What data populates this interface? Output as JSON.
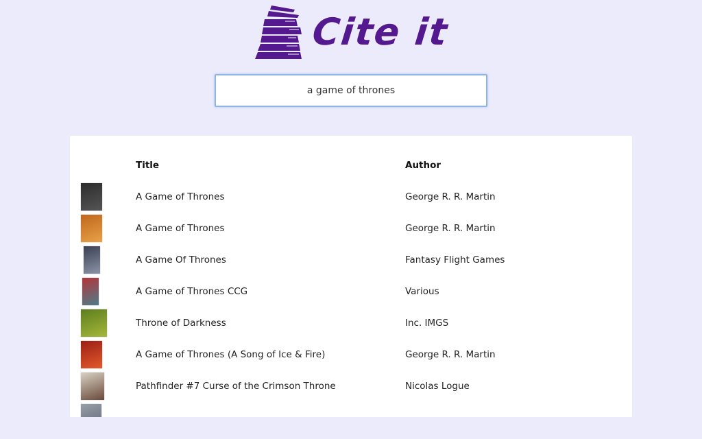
{
  "app": {
    "logo_text": "Cite it"
  },
  "search": {
    "value": "a game of thrones"
  },
  "table": {
    "headers": {
      "cover": "",
      "title": "Title",
      "author": "Author"
    },
    "rows": [
      {
        "title": "A Game of Thrones",
        "author": "George R. R. Martin",
        "thumb_colors": [
          "#2c2c2c",
          "#555555"
        ]
      },
      {
        "title": "A Game of Thrones",
        "author": "George R. R. Martin",
        "thumb_colors": [
          "#c0661c",
          "#e7a247"
        ]
      },
      {
        "title": "A Game Of Thrones",
        "author": "Fantasy Flight Games",
        "thumb_colors": [
          "#3a3f52",
          "#8c93a8"
        ]
      },
      {
        "title": "A Game of Thrones CCG",
        "author": "Various",
        "thumb_colors": [
          "#b2353a",
          "#4f7d8a"
        ]
      },
      {
        "title": "Throne of Darkness",
        "author": "Inc. IMGS",
        "thumb_colors": [
          "#5d7d1e",
          "#a6b83b"
        ]
      },
      {
        "title": "A Game of Thrones (A Song of Ice & Fire)",
        "author": "George R. R. Martin",
        "thumb_colors": [
          "#9a1e14",
          "#e25a2c"
        ]
      },
      {
        "title": "Pathfinder #7 Curse of the Crimson Throne",
        "author": "Nicolas Logue",
        "thumb_colors": [
          "#d8d2c4",
          "#6a4a3a"
        ]
      },
      {
        "title": "",
        "author": "",
        "thumb_colors": [
          "#9aa0a8",
          "#5a6070"
        ]
      }
    ]
  },
  "colors": {
    "background": "#ebebfc",
    "brand": "#55198f"
  }
}
